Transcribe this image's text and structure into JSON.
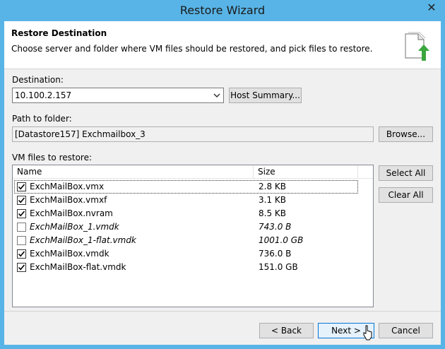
{
  "window": {
    "title": "Restore Wizard",
    "close_glyph": "✕"
  },
  "header": {
    "title": "Restore Destination",
    "description": "Choose server and folder where VM files should be restored, and pick files to restore.",
    "icon": "restore-files-icon"
  },
  "destination": {
    "label": "Destination:",
    "value": "10.100.2.157",
    "host_summary_label": "Host Summary..."
  },
  "path": {
    "label": "Path to folder:",
    "value": "[Datastore157] Exchmailbox_3",
    "browse_label": "Browse..."
  },
  "files": {
    "label": "VM files to restore:",
    "columns": {
      "name": "Name",
      "size": "Size"
    },
    "rows": [
      {
        "name": "ExchMailBox.vmx",
        "size": "2.8 KB",
        "checked": true,
        "italic": false
      },
      {
        "name": "ExchMailBox.vmxf",
        "size": "3.1 KB",
        "checked": true,
        "italic": false
      },
      {
        "name": "ExchMailBox.nvram",
        "size": "8.5 KB",
        "checked": true,
        "italic": false
      },
      {
        "name": "ExchMailBox_1.vmdk",
        "size": "743.0 B",
        "checked": false,
        "italic": true
      },
      {
        "name": "ExchMailBox_1-flat.vmdk",
        "size": "1001.0 GB",
        "checked": false,
        "italic": true
      },
      {
        "name": "ExchMailBox.vmdk",
        "size": "736.0 B",
        "checked": true,
        "italic": false
      },
      {
        "name": "ExchMailBox-flat.vmdk",
        "size": "151.0 GB",
        "checked": true,
        "italic": false
      }
    ],
    "select_all_label": "Select All",
    "clear_all_label": "Clear All"
  },
  "footer": {
    "back_label": "< Back",
    "next_label": "Next >",
    "cancel_label": "Cancel"
  },
  "colors": {
    "titlebar": "#58b4e6",
    "accent": "#0078d7",
    "arrow": "#3ca63c"
  }
}
